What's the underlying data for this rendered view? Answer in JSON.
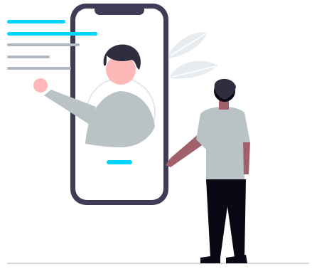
{
  "illustration": {
    "kind": "video-call",
    "icons": {
      "phone": "smartphone-icon",
      "remote_person": "video-caller-avatar",
      "viewer": "standing-person",
      "plant": "leaf-plant"
    },
    "colors": {
      "accent": "#00d4ff",
      "text_lines": "#b0b9c2",
      "phone_frame": "#3f3d56",
      "shirt": "#b9c2c4",
      "skin": "#ffb8b8",
      "arm_viewer": "#a0616a",
      "hair": "#2f2e41",
      "pants": "#090814",
      "leaves": "#e8ecef",
      "ground": "#d8d8d8"
    }
  }
}
